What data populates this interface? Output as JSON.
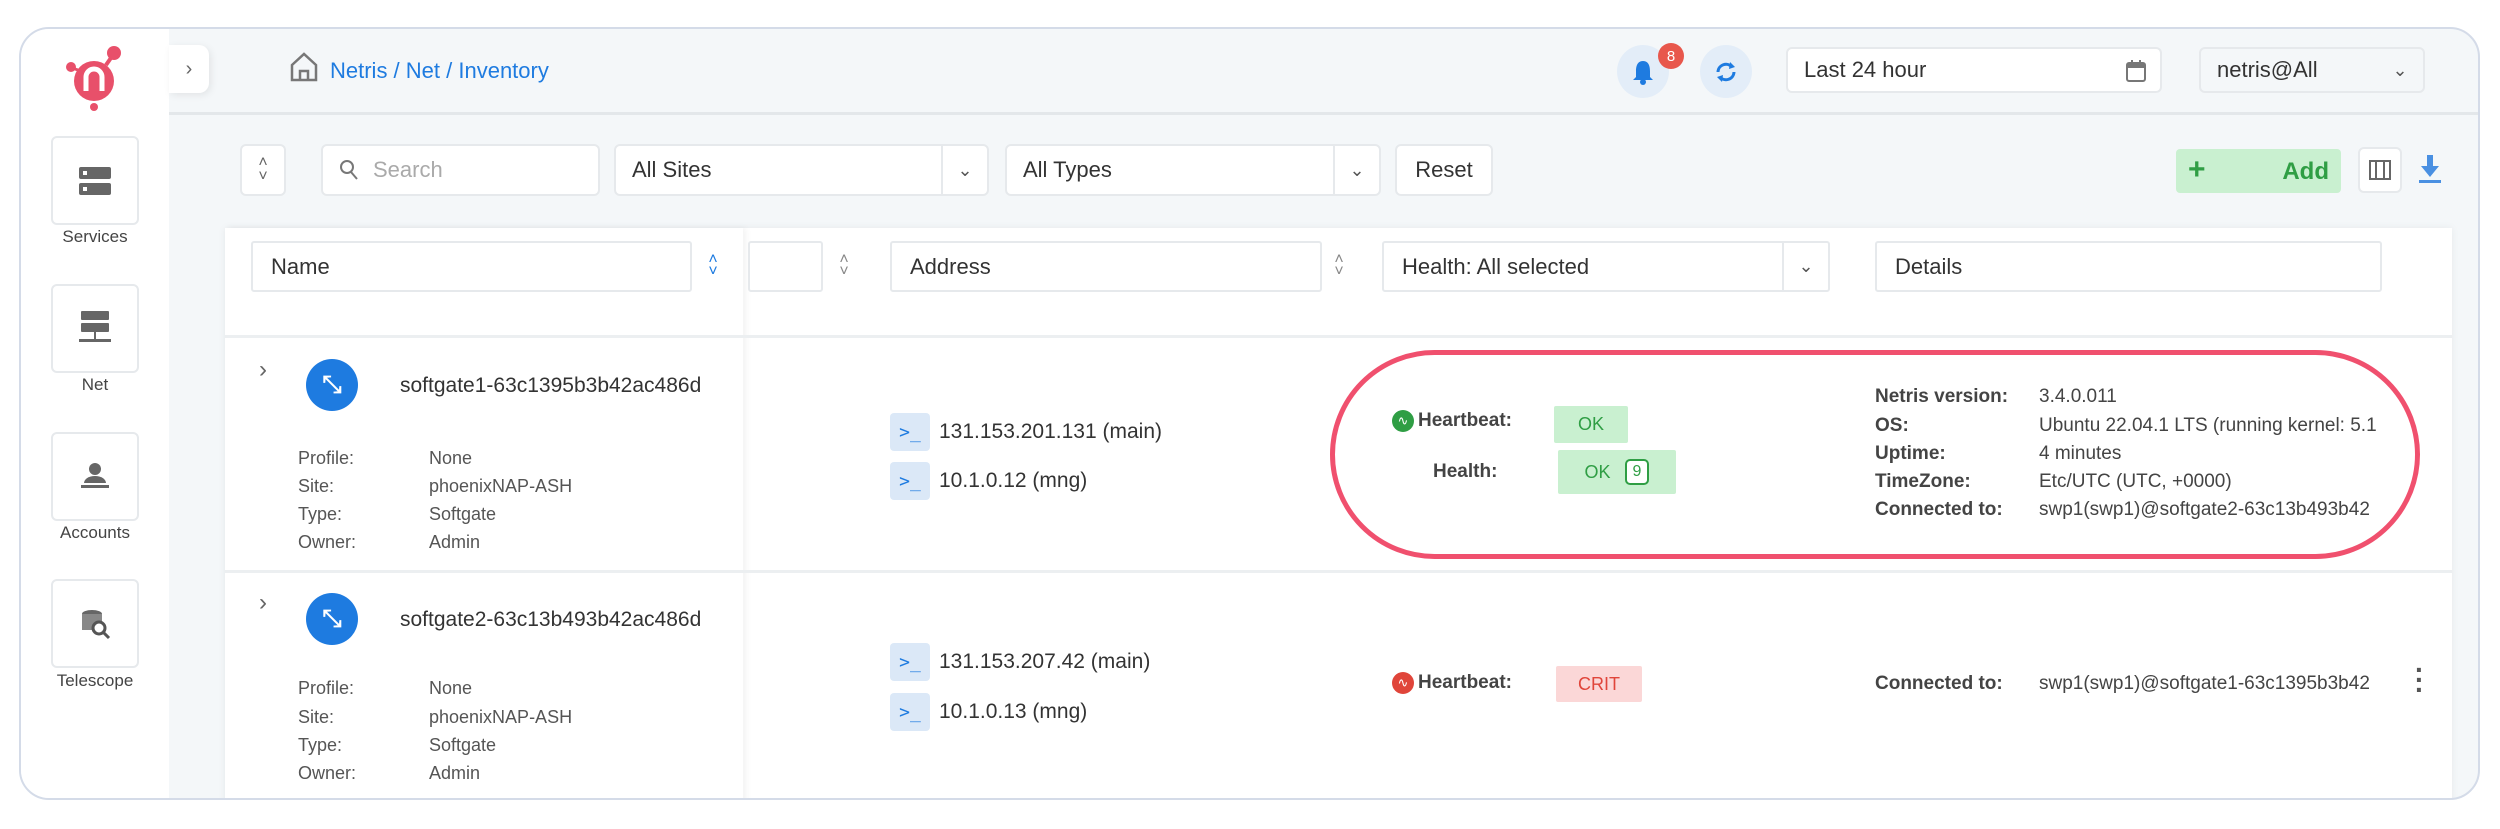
{
  "sidebar": {
    "items": [
      {
        "label": "Services",
        "icon": "services-icon"
      },
      {
        "label": "Net",
        "icon": "net-icon"
      },
      {
        "label": "Accounts",
        "icon": "accounts-icon"
      },
      {
        "label": "Telescope",
        "icon": "telescope-icon"
      }
    ]
  },
  "header": {
    "breadcrumb": "Netris / Net / Inventory",
    "notification_count": "8",
    "date_range": "Last 24 hour",
    "tenant": "netris@All"
  },
  "toolbar": {
    "search_placeholder": "Search",
    "sites_filter": "All Sites",
    "types_filter": "All Types",
    "reset_label": "Reset",
    "add_label": "Add"
  },
  "table": {
    "columns": {
      "name": "Name",
      "address": "Address",
      "health": "Health: All selected",
      "details": "Details"
    },
    "rows": [
      {
        "name": "softgate1-63c1395b3b42ac486d",
        "props": {
          "profile_label": "Profile:",
          "profile": "None",
          "site_label": "Site:",
          "site": "phoenixNAP-ASH",
          "type_label": "Type:",
          "type": "Softgate",
          "owner_label": "Owner:",
          "owner": "Admin"
        },
        "addresses": [
          "131.153.201.131 (main)",
          "10.1.0.12 (mng)"
        ],
        "heartbeat_label": "Heartbeat:",
        "heartbeat": "OK",
        "health_label": "Health:",
        "health": "OK",
        "health_count": "9",
        "details": [
          {
            "label": "Netris version:",
            "value": "3.4.0.011"
          },
          {
            "label": "OS:",
            "value": "Ubuntu 22.04.1 LTS (running kernel: 5.1"
          },
          {
            "label": "Uptime:",
            "value": "4 minutes"
          },
          {
            "label": "TimeZone:",
            "value": "Etc/UTC (UTC, +0000)"
          },
          {
            "label": "Connected to:",
            "value": "swp1(swp1)@softgate2-63c13b493b42"
          }
        ]
      },
      {
        "name": "softgate2-63c13b493b42ac486d",
        "props": {
          "profile_label": "Profile:",
          "profile": "None",
          "site_label": "Site:",
          "site": "phoenixNAP-ASH",
          "type_label": "Type:",
          "type": "Softgate",
          "owner_label": "Owner:",
          "owner": "Admin"
        },
        "addresses": [
          "131.153.207.42 (main)",
          "10.1.0.13 (mng)"
        ],
        "heartbeat_label": "Heartbeat:",
        "heartbeat": "CRIT",
        "details": [
          {
            "label": "Connected to:",
            "value": "swp1(swp1)@softgate1-63c1395b3b42"
          }
        ]
      }
    ]
  },
  "colors": {
    "accent": "#1e7be0",
    "brand": "#e8506a",
    "ok": "#2f9e44",
    "crit": "#e0453a",
    "highlight": "#f0506e"
  }
}
